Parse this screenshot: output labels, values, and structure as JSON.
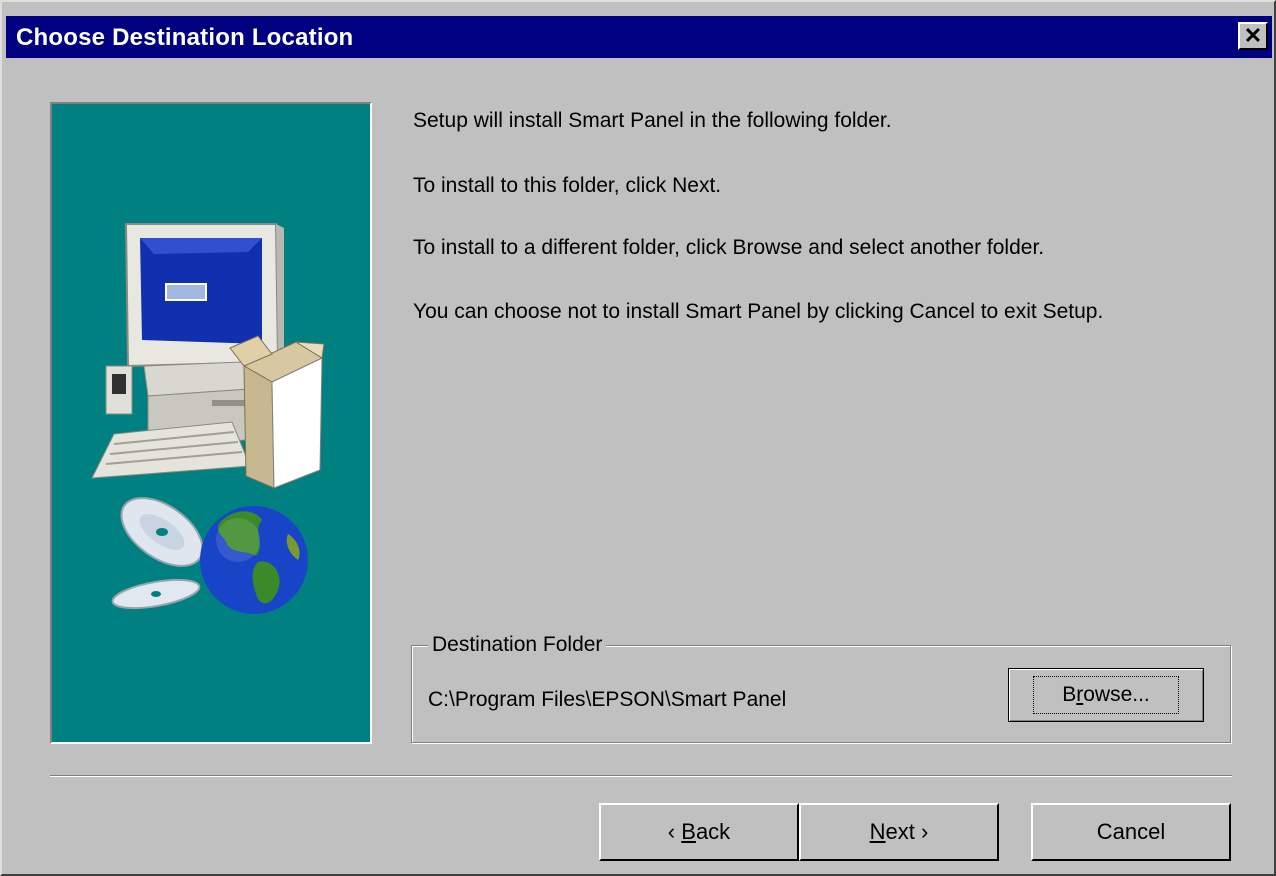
{
  "window": {
    "title": "Choose Destination Location",
    "close_glyph": "✕"
  },
  "messages": [
    "Setup will install Smart Panel in the following folder.",
    "To install to this folder, click Next.",
    "To install to a different folder, click Browse and select another folder.",
    "You can choose not to install Smart Panel by clicking Cancel to exit Setup."
  ],
  "destination": {
    "group_label": "Destination Folder",
    "path": "C:\\Program Files\\EPSON\\Smart Panel",
    "browse_label": {
      "pre": "B",
      "accel": "r",
      "post": "owse..."
    }
  },
  "buttons": {
    "back": {
      "arrow": "‹",
      "accel": "B",
      "post": "ack"
    },
    "next": {
      "accel": "N",
      "post": "ext",
      "arrow": "›"
    },
    "cancel": "Cancel"
  },
  "icons": {
    "close": "close-icon",
    "installer_art": "computer-with-box-and-globe-illustration"
  },
  "colors": {
    "titlebar": "#000080",
    "face": "#c0c0c0",
    "art_background": "#008080"
  }
}
